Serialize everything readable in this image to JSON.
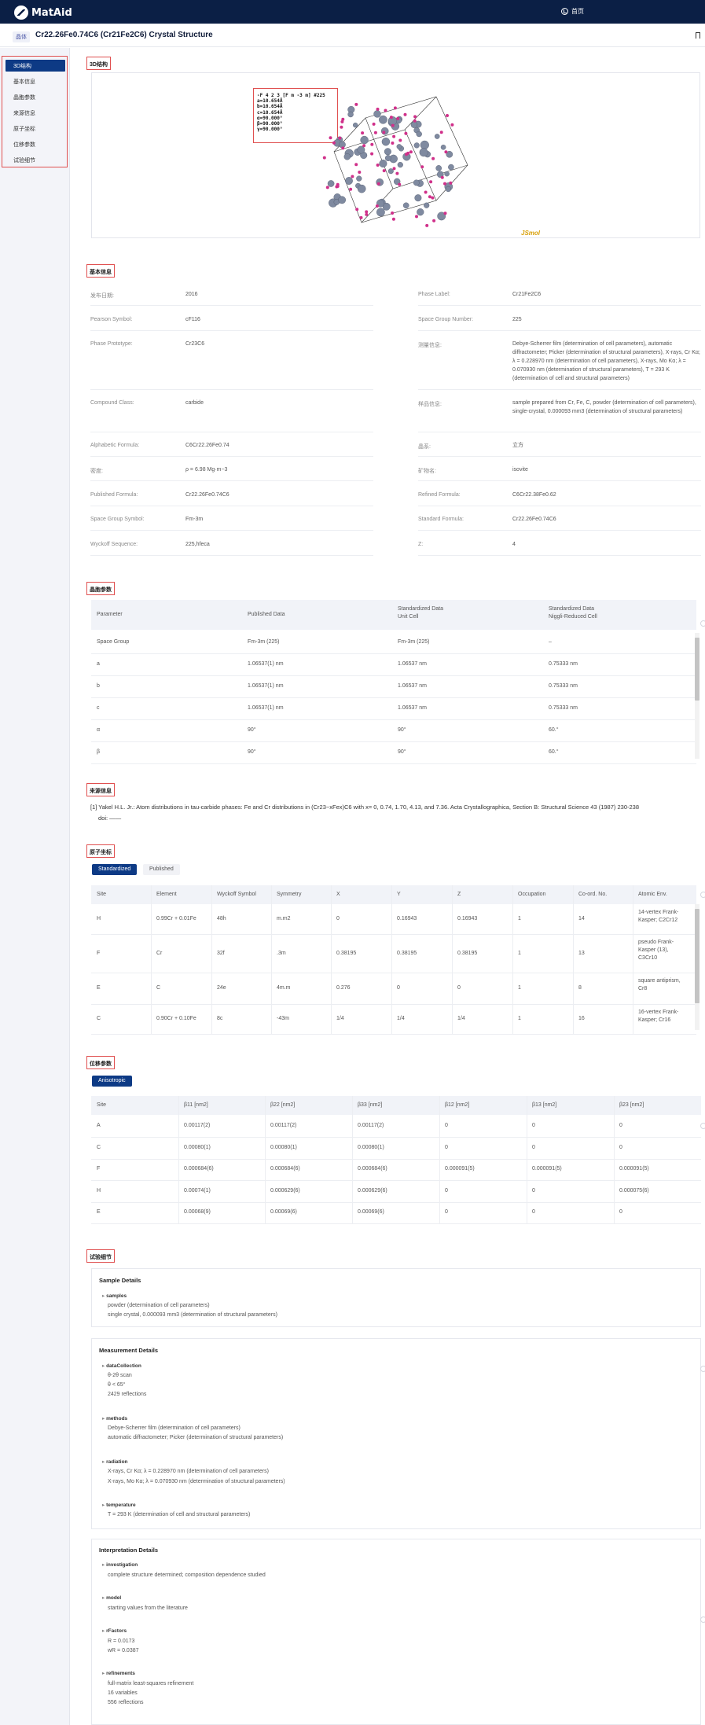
{
  "app": {
    "name": "MatAid",
    "home_label": "首页"
  },
  "title": {
    "tag": "晶体",
    "text": "Cr22.26Fe0.74C6 (Cr21Fe2C6) Crystal Structure"
  },
  "sidebar": {
    "items": [
      "3D结构",
      "基本信息",
      "晶胞参数",
      "来源信息",
      "原子坐标",
      "位移参数",
      "试验细节"
    ]
  },
  "sections": {
    "structure3d": "3D结构",
    "basic": "基本信息",
    "cell": "晶胞参数",
    "source": "来源信息",
    "atoms": "原子坐标",
    "displacement": "位移参数",
    "experiment": "试验细节"
  },
  "viewer": {
    "cell_lines": [
      "-F 4 2 3 [F m -3 m] #225",
      "a=10.654Å",
      "b=10.654Å",
      "c=10.654Å",
      "α=90.000°",
      "β=90.000°",
      "γ=90.000°"
    ],
    "brand": "JSmol"
  },
  "basic_info": {
    "left": [
      {
        "label": "发布日期:",
        "value": "2016"
      },
      {
        "label": "Pearson Symbol:",
        "value": "cF116"
      },
      {
        "label": "Phase Prototype:",
        "value": "Cr23C6"
      },
      {
        "label": "Compound Class:",
        "value": "carbide"
      },
      {
        "label": "Alphabetic Formula:",
        "value": "C6Cr22.26Fe0.74"
      },
      {
        "label": "密度:",
        "value": "ρ = 6.98 Mg·m−3"
      },
      {
        "label": "Published Formula:",
        "value": "Cr22.26Fe0.74C6"
      },
      {
        "label": "Space Group Symbol:",
        "value": "Fm-3m"
      },
      {
        "label": "Wyckoff Sequence:",
        "value": "225,hfeca"
      }
    ],
    "right": [
      {
        "label": "Phase Label:",
        "value": "Cr21Fe2C6"
      },
      {
        "label": "Space Group Number:",
        "value": "225"
      },
      {
        "label": "测量信息:",
        "value": "Debye-Scherrer film (determination of cell parameters), automatic diffractometer; Picker (determination of structural parameters), X-rays, Cr Kα; λ = 0.228970 nm (determination of cell parameters), X-rays, Mo Kα; λ = 0.070930 nm (determination of structural parameters), T = 293 K (determination of cell and structural parameters)"
      },
      {
        "label": "样品信息:",
        "value": "sample prepared from Cr, Fe, C, powder (determination of cell parameters), single-crystal, 0.000093 mm3 (determination of structural parameters)"
      },
      {
        "label": "晶系:",
        "value": "立方"
      },
      {
        "label": "矿物名:",
        "value": "isovite"
      },
      {
        "label": "Refined Formula:",
        "value": "C6Cr22.38Fe0.62"
      },
      {
        "label": "Standard Formula:",
        "value": "Cr22.26Fe0.74C6"
      },
      {
        "label": "Z:",
        "value": "4"
      }
    ]
  },
  "cell_table": {
    "headers": [
      "Parameter",
      "Published Data",
      "Standardized Data\nUnit Cell",
      "Standardized Data\nNiggli-Reduced Cell"
    ],
    "rows": [
      [
        "Space Group",
        "Fm-3m (225)",
        "Fm-3m (225)",
        "–"
      ],
      [
        "a",
        "1.06537(1) nm",
        "1.06537 nm",
        "0.75333 nm"
      ],
      [
        "b",
        "1.06537(1) nm",
        "1.06537 nm",
        "0.75333 nm"
      ],
      [
        "c",
        "1.06537(1) nm",
        "1.06537 nm",
        "0.75333 nm"
      ],
      [
        "α",
        "90°",
        "90°",
        "60.°"
      ],
      [
        "β",
        "90°",
        "90°",
        "60.°"
      ]
    ]
  },
  "source": {
    "citation": "[1] Yakel H.L. Jr.: Atom distributions in tau-carbide phases: Fe and Cr distributions in (Cr23−xFex)C6 with x= 0, 0.74, 1.70, 4.13, and 7.36. Acta Crystallographica, Section B: Structural Science 43 (1987) 230-238",
    "doi": "doi: ——"
  },
  "atoms": {
    "tabs": [
      "Standardized",
      "Published"
    ],
    "headers": [
      "Site",
      "Element",
      "Wyckoff Symbol",
      "Symmetry",
      "X",
      "Y",
      "Z",
      "Occupation",
      "Co-ord. No.",
      "Atomic Env."
    ],
    "rows": [
      [
        "H",
        "0.99Cr + 0.01Fe",
        "48h",
        "m.m2",
        "0",
        "0.16943",
        "0.16943",
        "1",
        "14",
        "14-vertex Frank-Kasper; C2Cr12"
      ],
      [
        "F",
        "Cr",
        "32f",
        ".3m",
        "0.38195",
        "0.38195",
        "0.38195",
        "1",
        "13",
        "pseudo Frank-Kasper (13), C3Cr10"
      ],
      [
        "E",
        "C",
        "24e",
        "4m.m",
        "0.276",
        "0",
        "0",
        "1",
        "8",
        "square antiprism, Cr8"
      ],
      [
        "C",
        "0.90Cr + 0.10Fe",
        "8c",
        "-43m",
        "1/4",
        "1/4",
        "1/4",
        "1",
        "16",
        "16-vertex Frank-Kasper; Cr16"
      ]
    ]
  },
  "displacement": {
    "tab": "Anisotropic",
    "headers": [
      "Site",
      "β11 [nm2]",
      "β22 [nm2]",
      "β33 [nm2]",
      "β12 [nm2]",
      "β13 [nm2]",
      "β23 [nm2]"
    ],
    "rows": [
      [
        "A",
        "0.00117(2)",
        "0.00117(2)",
        "0.00117(2)",
        "0",
        "0",
        "0"
      ],
      [
        "C",
        "0.00080(1)",
        "0.00080(1)",
        "0.00080(1)",
        "0",
        "0",
        "0"
      ],
      [
        "F",
        "0.000684(6)",
        "0.000684(6)",
        "0.000684(6)",
        "0.000091(5)",
        "0.000091(5)",
        "0.000091(5)"
      ],
      [
        "H",
        "0.00074(1)",
        "0.000629(6)",
        "0.000629(6)",
        "0",
        "0",
        "0.000075(6)"
      ],
      [
        "E",
        "0.00068(9)",
        "0.00069(6)",
        "0.00069(6)",
        "0",
        "0",
        "0"
      ]
    ]
  },
  "experiment": {
    "sample": {
      "title": "Sample Details",
      "key": "samples",
      "lines": [
        "powder (determination of cell parameters)",
        "single crystal, 0.000093 mm3 (determination of structural parameters)"
      ]
    },
    "measurement": {
      "title": "Measurement Details",
      "groups": [
        {
          "key": "dataCollection",
          "lines": [
            "θ-2θ scan",
            "θ < 65°",
            "2429 reflections"
          ]
        },
        {
          "key": "methods",
          "lines": [
            "Debye-Scherrer film (determination of cell parameters)",
            "automatic diffractometer; Picker (determination of structural parameters)"
          ]
        },
        {
          "key": "radiation",
          "lines": [
            "X-rays, Cr Kα; λ = 0.228970 nm (determination of cell parameters)",
            "X-rays, Mo Kα; λ = 0.070930 nm (determination of structural parameters)"
          ]
        },
        {
          "key": "temperature",
          "lines": [
            "T = 293 K (determination of cell and structural parameters)"
          ]
        }
      ]
    },
    "interpretation": {
      "title": "Interpretation Details",
      "groups": [
        {
          "key": "investigation",
          "lines": [
            "complete structure determined; composition dependence studied"
          ]
        },
        {
          "key": "model",
          "lines": [
            "starting values from the literature"
          ]
        },
        {
          "key": "rFactors",
          "lines": [
            "R = 0.0173",
            "wR = 0.0387"
          ]
        },
        {
          "key": "refinements",
          "lines": [
            "full-matrix least-squares refinement",
            "16 variables",
            "556 reflections"
          ]
        }
      ]
    }
  },
  "colors": {
    "navy": "#0b1f45",
    "accent": "#0d3a85",
    "highlight_border": "#e05050",
    "jsmol": "#d8a10c"
  }
}
